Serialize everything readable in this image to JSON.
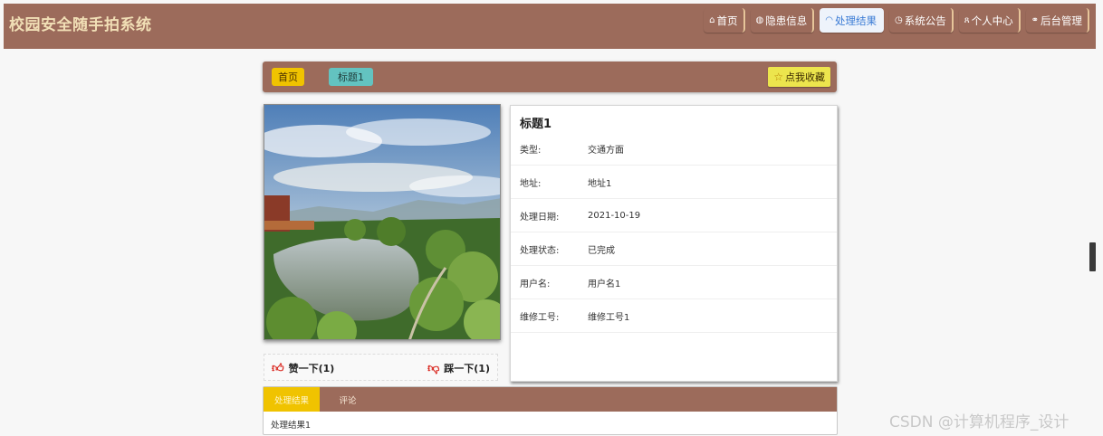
{
  "header": {
    "brand": "校园安全随手拍系统",
    "nav": [
      {
        "icon": "home-icon",
        "glyph": "⌂",
        "label": "首页",
        "active": false
      },
      {
        "icon": "globe-icon",
        "glyph": "◍",
        "label": "隐患信息",
        "active": false
      },
      {
        "icon": "gauge-icon",
        "glyph": "◠",
        "label": "处理结果",
        "active": true
      },
      {
        "icon": "clock-icon",
        "glyph": "◷",
        "label": "系统公告",
        "active": false
      },
      {
        "icon": "user-icon",
        "glyph": "ጸ",
        "label": "个人中心",
        "active": false
      },
      {
        "icon": "link-icon",
        "glyph": "⚭",
        "label": "后台管理",
        "active": false
      }
    ]
  },
  "breadcrumb": {
    "home": "首页",
    "current": "标题1"
  },
  "favorite": {
    "label": "点我收藏"
  },
  "detail": {
    "title": "标题1",
    "rows": [
      {
        "k": "类型:",
        "v": "交通方面"
      },
      {
        "k": "地址:",
        "v": "地址1"
      },
      {
        "k": "处理日期:",
        "v": "2021-10-19"
      },
      {
        "k": "处理状态:",
        "v": "已完成"
      },
      {
        "k": "用户名:",
        "v": "用户名1"
      },
      {
        "k": "维修工号:",
        "v": "维修工号1"
      }
    ]
  },
  "votes": {
    "like": "赞一下(1)",
    "dislike": "踩一下(1)"
  },
  "tabs": {
    "items": [
      {
        "label": "处理结果",
        "active": true
      },
      {
        "label": "评论",
        "active": false
      }
    ],
    "content": "处理结果1"
  },
  "watermark": "CSDN @计算机程序_设计",
  "colors": {
    "header_bg": "#9c6b5b",
    "brand_text": "#f1dfb6",
    "accent_yellow": "#f0c300",
    "accent_teal": "#63c3c0",
    "favorite_bg": "#ece54d",
    "active_nav": "#3a7bd5"
  }
}
